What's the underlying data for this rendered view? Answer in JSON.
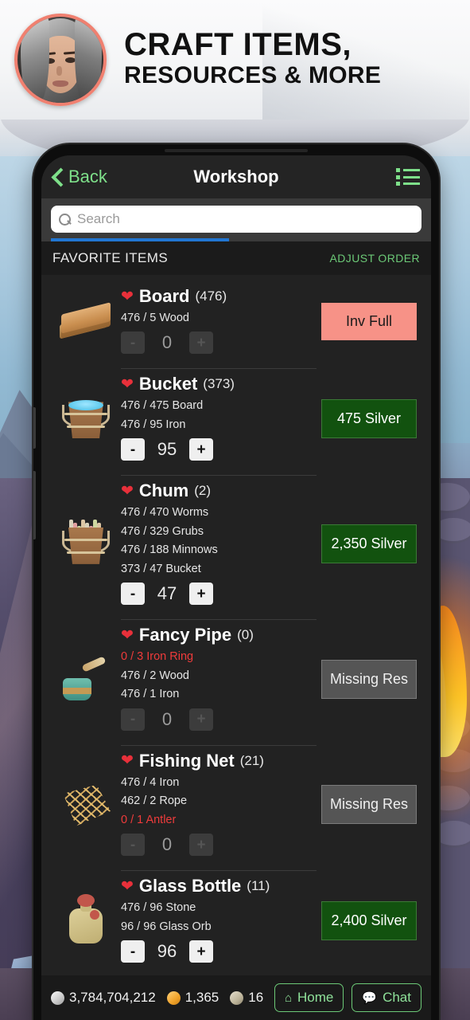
{
  "banner": {
    "line1": "CRAFT ITEMS,",
    "line2": "RESOURCES & MORE",
    "avatar_name": "player-portrait"
  },
  "navbar": {
    "back_label": "Back",
    "title": "Workshop",
    "menu_icon": "list-menu-icon"
  },
  "search": {
    "placeholder": "Search",
    "value": "",
    "icon": "search-icon",
    "progress_percent": 48
  },
  "section": {
    "title": "FAVORITE ITEMS",
    "adjust_order_label": "ADJUST ORDER"
  },
  "colors": {
    "accent_green": "#7ee08a",
    "heart_red": "#e8303a",
    "missing_red": "#ef3b3b",
    "buy_green_bg": "#12520f",
    "inv_full_bg": "#f79287",
    "missing_res_bg": "#555555",
    "progress_blue": "#2176d2"
  },
  "items": [
    {
      "name": "Board",
      "count": "(476)",
      "icon": "board-icon",
      "favorited": true,
      "requirements": [
        {
          "text": "476 / 5 Wood",
          "missing": false
        }
      ],
      "stepper": {
        "value": "0",
        "minus": "-",
        "plus": "+",
        "enabled": false
      },
      "action": {
        "label": "Inv Full",
        "state": "inv-full"
      }
    },
    {
      "name": "Bucket",
      "count": "(373)",
      "icon": "bucket-icon",
      "favorited": true,
      "requirements": [
        {
          "text": "476 / 475 Board",
          "missing": false
        },
        {
          "text": "476 / 95 Iron",
          "missing": false
        }
      ],
      "stepper": {
        "value": "95",
        "minus": "-",
        "plus": "+",
        "enabled": true
      },
      "action": {
        "label": "475 Silver",
        "state": "buy"
      }
    },
    {
      "name": "Chum",
      "count": "(2)",
      "icon": "chum-bucket-icon",
      "favorited": true,
      "requirements": [
        {
          "text": "476 / 470 Worms",
          "missing": false
        },
        {
          "text": "476 / 329 Grubs",
          "missing": false
        },
        {
          "text": "476 / 188 Minnows",
          "missing": false
        },
        {
          "text": "373 / 47 Bucket",
          "missing": false
        }
      ],
      "stepper": {
        "value": "47",
        "minus": "-",
        "plus": "+",
        "enabled": true
      },
      "action": {
        "label": "2,350 Silver",
        "state": "buy"
      }
    },
    {
      "name": "Fancy Pipe",
      "count": "(0)",
      "icon": "pipe-icon",
      "favorited": true,
      "requirements": [
        {
          "text": "0 / 3 Iron Ring",
          "missing": true
        },
        {
          "text": "476 / 2 Wood",
          "missing": false
        },
        {
          "text": "476 / 1 Iron",
          "missing": false
        }
      ],
      "stepper": {
        "value": "0",
        "minus": "-",
        "plus": "+",
        "enabled": false
      },
      "action": {
        "label": "Missing Res",
        "state": "missing"
      }
    },
    {
      "name": "Fishing Net",
      "count": "(21)",
      "icon": "fishing-net-icon",
      "favorited": true,
      "requirements": [
        {
          "text": "476 / 4 Iron",
          "missing": false
        },
        {
          "text": "462 / 2 Rope",
          "missing": false
        },
        {
          "text": "0 / 1 Antler",
          "missing": true
        }
      ],
      "stepper": {
        "value": "0",
        "minus": "-",
        "plus": "+",
        "enabled": false
      },
      "action": {
        "label": "Missing Res",
        "state": "missing"
      }
    },
    {
      "name": "Glass Bottle",
      "count": "(11)",
      "icon": "glass-bottle-icon",
      "favorited": true,
      "requirements": [
        {
          "text": "476 / 96 Stone",
          "missing": false
        },
        {
          "text": "96 / 96 Glass Orb",
          "missing": false
        }
      ],
      "stepper": {
        "value": "96",
        "minus": "-",
        "plus": "+",
        "enabled": true
      },
      "action": {
        "label": "2,400 Silver",
        "state": "buy"
      }
    }
  ],
  "bottom_bar": {
    "currencies": [
      {
        "icon": "silver-coin-icon",
        "type": "silver",
        "value": "3,784,704,212"
      },
      {
        "icon": "gold-coin-icon",
        "type": "gold",
        "value": "1,365"
      },
      {
        "icon": "bronze-coin-icon",
        "type": "bronze",
        "value": "16"
      }
    ],
    "buttons": [
      {
        "icon": "home-icon",
        "glyph": "⌂",
        "label": "Home"
      },
      {
        "icon": "chat-icon",
        "glyph": "💬",
        "label": "Chat"
      }
    ]
  }
}
